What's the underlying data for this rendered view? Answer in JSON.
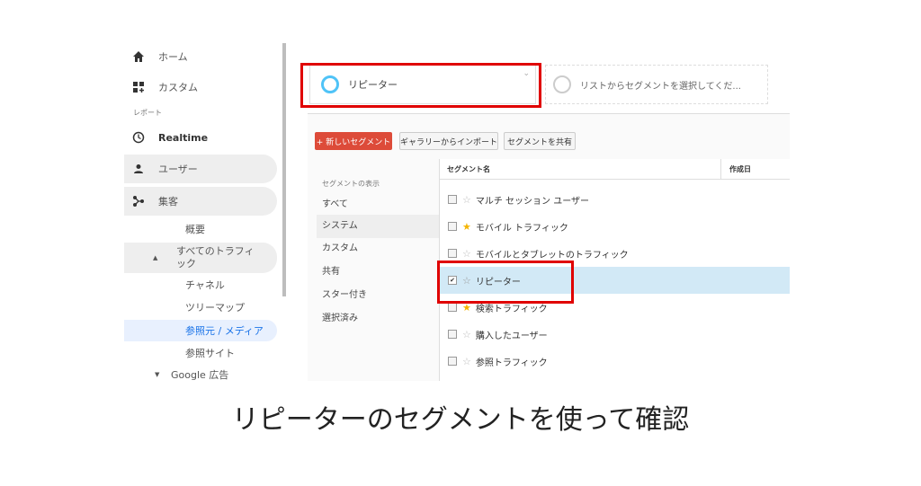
{
  "sidebar": {
    "home": "ホーム",
    "custom": "カスタム",
    "reports_heading": "レポート",
    "realtime": "Realtime",
    "user": "ユーザー",
    "acquisition": "集客",
    "overview": "概要",
    "all_traffic": "すべてのトラフィ\nック",
    "channel": "チャネル",
    "treemap": "ツリーマップ",
    "source_medium": "参照元 / メディア",
    "referral": "参照サイト",
    "google_ads": "Google 広告"
  },
  "segment_header": {
    "selected": "リピーター",
    "placeholder": "リストからセグメントを選択してくだ..."
  },
  "toolbar": {
    "new_segment": "+ 新しいセグメント",
    "import_gallery": "ギャラリーからインポート",
    "share_segment": "セグメントを共有"
  },
  "filters": {
    "label": "セグメントの表示",
    "items": [
      "すべて",
      "システム",
      "カスタム",
      "共有",
      "スター付き",
      "選択済み"
    ]
  },
  "table": {
    "col_name": "セグメント名",
    "col_created": "作成日",
    "rows": [
      {
        "name": "マルチ セッション ユーザー",
        "starred": false,
        "checked": false
      },
      {
        "name": "モバイル トラフィック",
        "starred": true,
        "checked": false
      },
      {
        "name": "モバイルとタブレットのトラフィック",
        "starred": false,
        "checked": false
      },
      {
        "name": "リピーター",
        "starred": false,
        "checked": true
      },
      {
        "name": "検索トラフィック",
        "starred": true,
        "checked": false
      },
      {
        "name": "購入したユーザー",
        "starred": false,
        "checked": false
      },
      {
        "name": "参照トラフィック",
        "starred": false,
        "checked": false
      }
    ]
  },
  "caption": "リピーターのセグメントを使って確認",
  "colors": {
    "highlight_red": "#e00000",
    "new_button": "#dd4b39",
    "selected_row": "#d2e9f6",
    "star_gold": "#f4b400"
  }
}
